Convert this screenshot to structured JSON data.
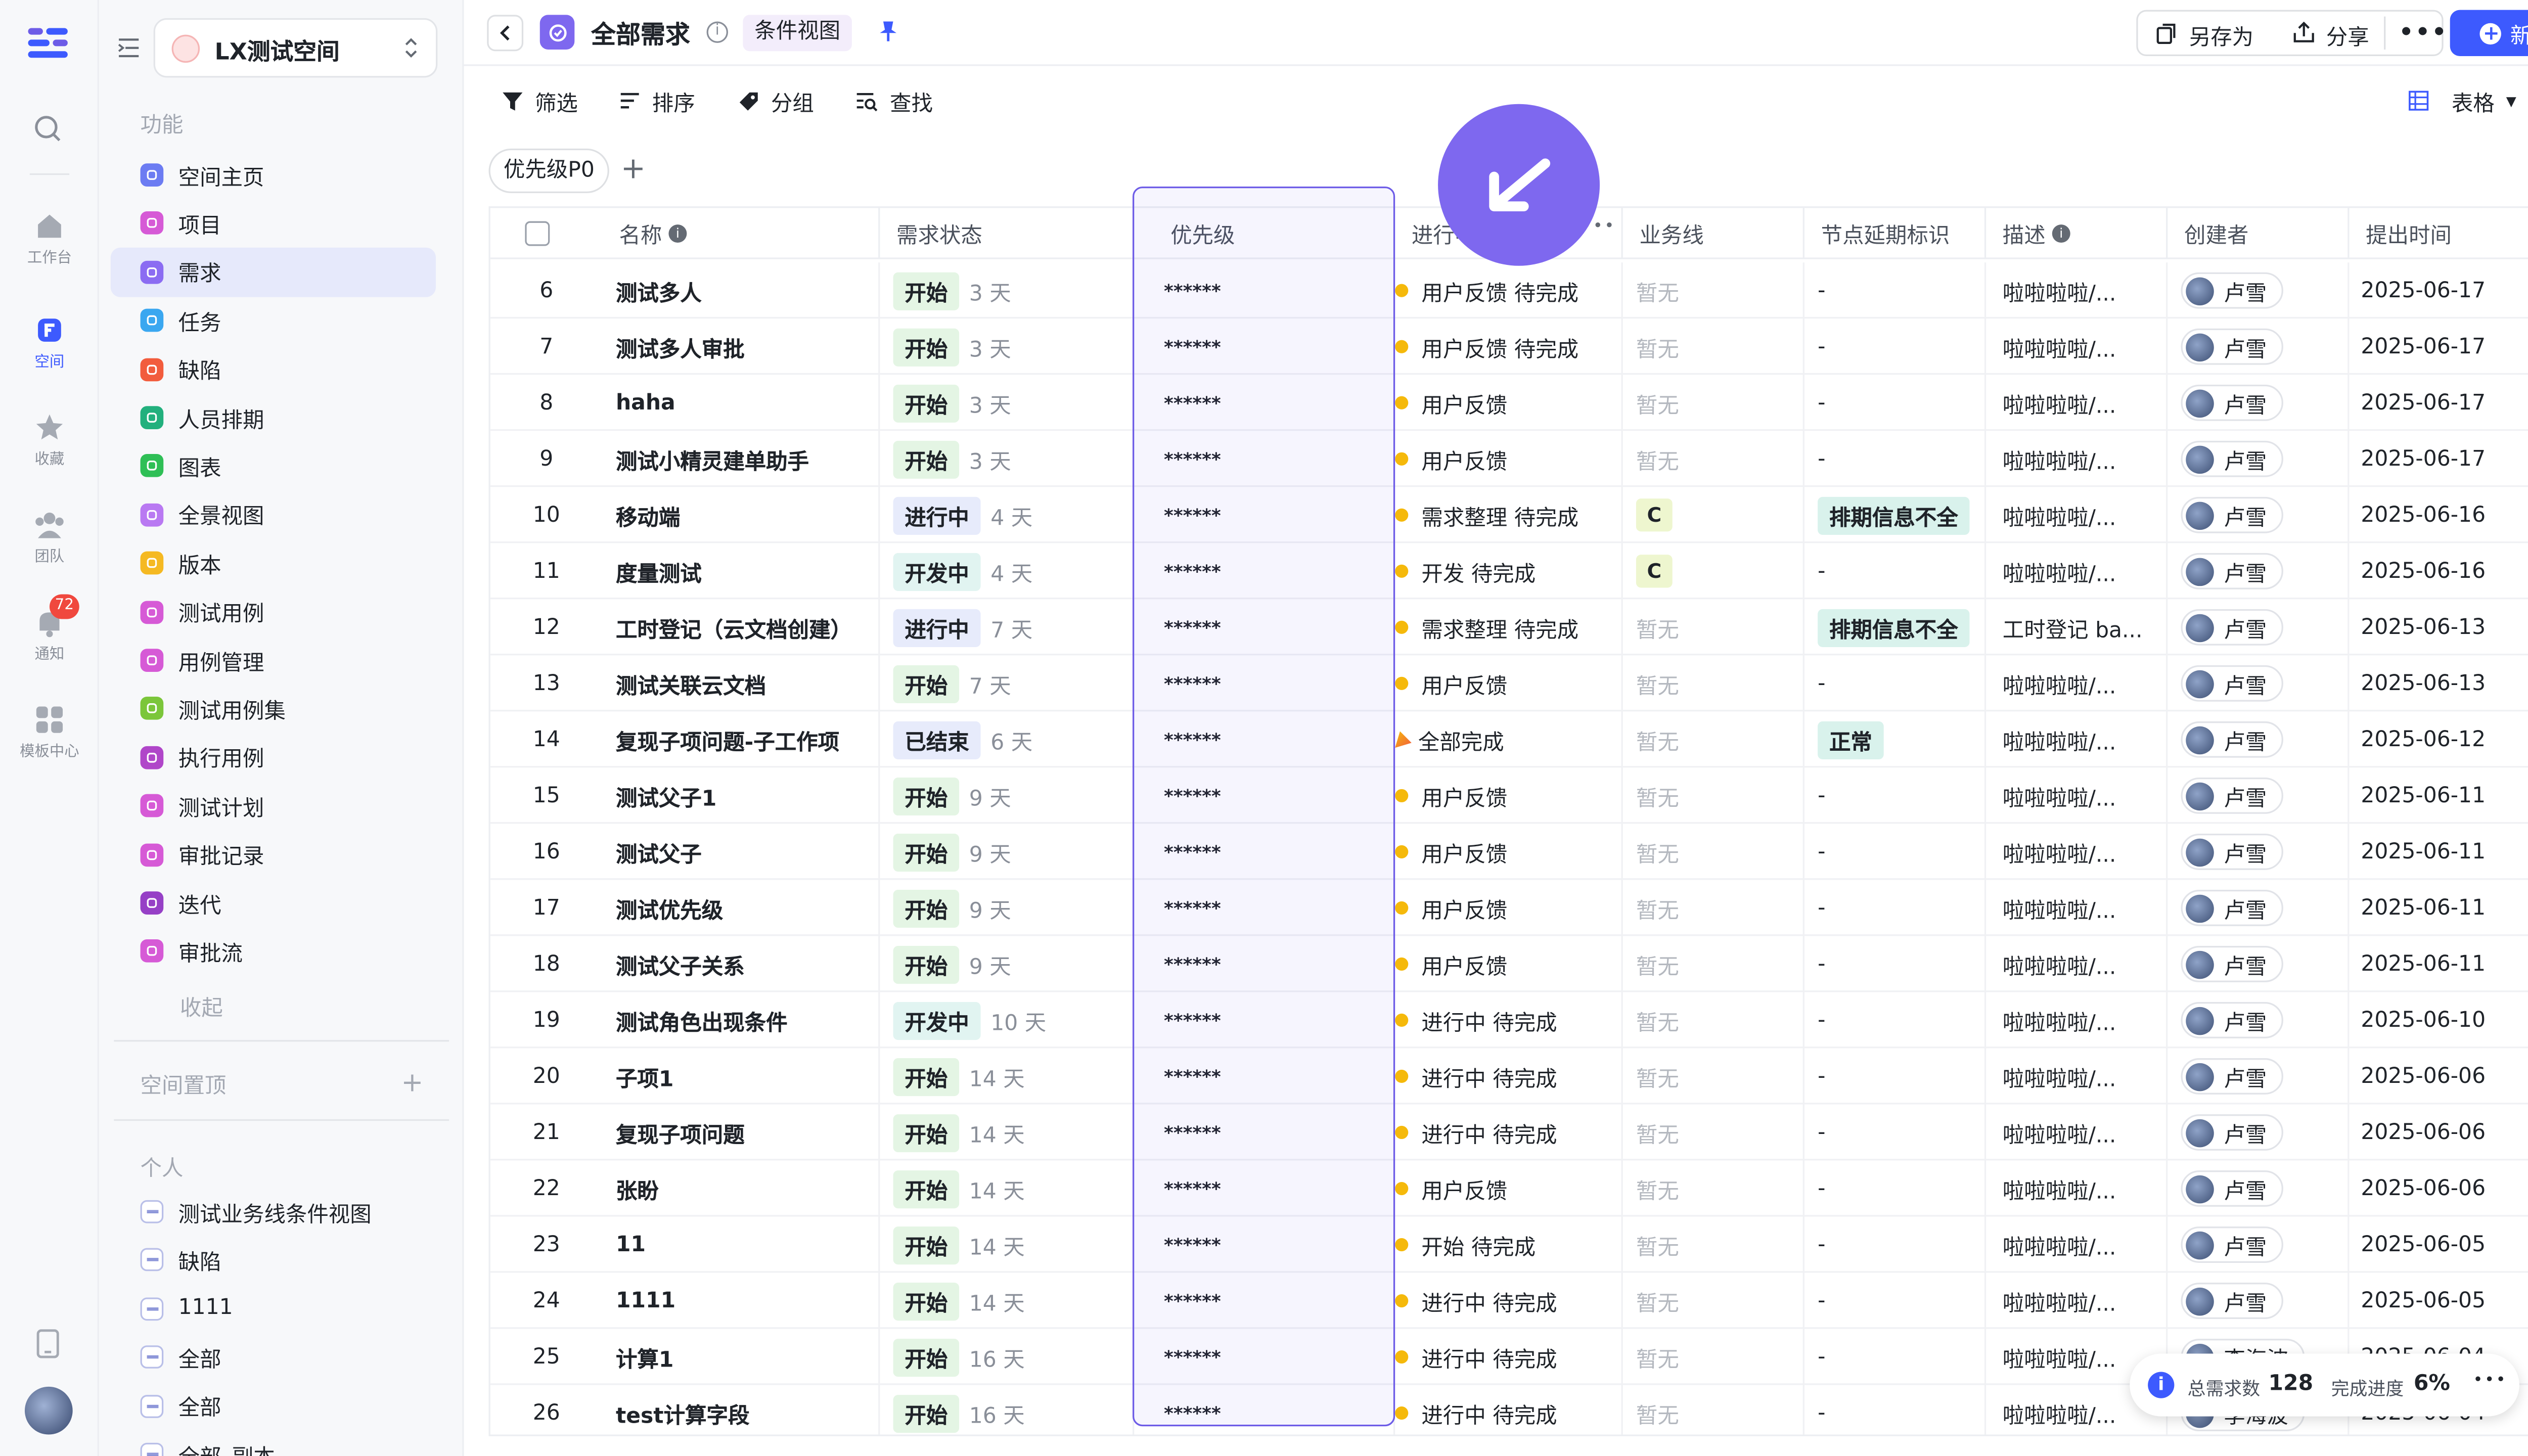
{
  "rail": {
    "items": [
      {
        "label": "工作台",
        "icon": "home-icon"
      },
      {
        "label": "空间",
        "icon": "space-icon"
      },
      {
        "label": "收藏",
        "icon": "star-icon"
      },
      {
        "label": "团队",
        "icon": "team-icon"
      },
      {
        "label": "通知",
        "icon": "bell-icon",
        "badge": "72"
      },
      {
        "label": "模板中心",
        "icon": "template-icon"
      }
    ]
  },
  "sidebar": {
    "space_name": "LX测试空间",
    "section_features": "功能",
    "items": [
      {
        "label": "空间主页",
        "color": "#6c7cf2"
      },
      {
        "label": "项目",
        "color": "#d65ad6"
      },
      {
        "label": "需求",
        "color": "#8b6cf2"
      },
      {
        "label": "任务",
        "color": "#3aa7f0"
      },
      {
        "label": "缺陷",
        "color": "#f25c3d"
      },
      {
        "label": "人员排期",
        "color": "#22b07d"
      },
      {
        "label": "图表",
        "color": "#2fbf56"
      },
      {
        "label": "全景视图",
        "color": "#b979f2"
      },
      {
        "label": "版本",
        "color": "#f5b922"
      },
      {
        "label": "测试用例",
        "color": "#d65ad6"
      },
      {
        "label": "用例管理",
        "color": "#d65ad6"
      },
      {
        "label": "测试用例集",
        "color": "#7bc63a"
      },
      {
        "label": "执行用例",
        "color": "#b046c9"
      },
      {
        "label": "测试计划",
        "color": "#d65ad6"
      },
      {
        "label": "审批记录",
        "color": "#d65ad6"
      },
      {
        "label": "迭代",
        "color": "#9640c6"
      },
      {
        "label": "审批流",
        "color": "#d65ad6"
      }
    ],
    "collapse": "收起",
    "section_pinned": "空间置顶",
    "section_personal": "个人",
    "personal": [
      "测试业务线条件视图",
      "缺陷",
      "1111",
      "全部",
      "全部",
      "全部_副本"
    ]
  },
  "header": {
    "title": "全部需求",
    "view_tag": "条件视图",
    "save_as": "另存为",
    "share": "分享",
    "new": "新建"
  },
  "toolbar": {
    "filter": "筛选",
    "sort": "排序",
    "group": "分组",
    "find": "查找",
    "view": "表格"
  },
  "group_tab": "优先级P0",
  "columns": [
    "名称",
    "需求状态",
    "优先级",
    "进行中",
    "业务线",
    "节点延期标识",
    "描述",
    "创建者",
    "提出时间"
  ],
  "rows": [
    {
      "no": "6",
      "name": "测试多人",
      "status": "开始",
      "st": "start",
      "days": "3 天",
      "pri": "******",
      "prog": "用户反馈 待完成",
      "biz": "暂无",
      "delay": "-",
      "desc": "啦啦啦啦/...",
      "creator": "卢雪",
      "date": "2025-06-17"
    },
    {
      "no": "7",
      "name": "测试多人审批",
      "status": "开始",
      "st": "start",
      "days": "3 天",
      "pri": "******",
      "prog": "用户反馈 待完成",
      "biz": "暂无",
      "delay": "-",
      "desc": "啦啦啦啦/...",
      "creator": "卢雪",
      "date": "2025-06-17"
    },
    {
      "no": "8",
      "name": "haha",
      "status": "开始",
      "st": "start",
      "days": "3 天",
      "pri": "******",
      "prog": "用户反馈",
      "biz": "暂无",
      "delay": "-",
      "desc": "啦啦啦啦/...",
      "creator": "卢雪",
      "date": "2025-06-17"
    },
    {
      "no": "9",
      "name": "测试小精灵建单助手",
      "status": "开始",
      "st": "start",
      "days": "3 天",
      "pri": "******",
      "prog": "用户反馈",
      "biz": "暂无",
      "delay": "-",
      "desc": "啦啦啦啦/...",
      "creator": "卢雪",
      "date": "2025-06-17"
    },
    {
      "no": "10",
      "name": "移动端",
      "status": "进行中",
      "st": "doing",
      "days": "4 天",
      "pri": "******",
      "prog": "需求整理 待完成",
      "biz": "C",
      "delay": "排期信息不全",
      "desc": "啦啦啦啦/...",
      "creator": "卢雪",
      "date": "2025-06-16"
    },
    {
      "no": "11",
      "name": "度量测试",
      "status": "开发中",
      "st": "dev",
      "days": "4 天",
      "pri": "******",
      "prog": "开发 待完成",
      "biz": "C",
      "delay": "-",
      "desc": "啦啦啦啦/...",
      "creator": "卢雪",
      "date": "2025-06-16"
    },
    {
      "no": "12",
      "name": "工时登记（云文档创建）",
      "status": "进行中",
      "st": "doing",
      "days": "7 天",
      "pri": "******",
      "prog": "需求整理 待完成",
      "biz": "暂无",
      "delay": "排期信息不全",
      "desc": "工时登记 ba...",
      "creator": "卢雪",
      "date": "2025-06-13"
    },
    {
      "no": "13",
      "name": "测试关联云文档",
      "status": "开始",
      "st": "start",
      "days": "7 天",
      "pri": "******",
      "prog": "用户反馈",
      "biz": "暂无",
      "delay": "-",
      "desc": "啦啦啦啦/...",
      "creator": "卢雪",
      "date": "2025-06-13"
    },
    {
      "no": "14",
      "name": "复现子项问题-子工作项",
      "status": "已结束",
      "st": "end",
      "days": "6 天",
      "pri": "******",
      "prog": "全部完成",
      "biz": "暂无",
      "delay": "正常",
      "desc": "啦啦啦啦/...",
      "creator": "卢雪",
      "date": "2025-06-12"
    },
    {
      "no": "15",
      "name": "测试父子1",
      "status": "开始",
      "st": "start",
      "days": "9 天",
      "pri": "******",
      "prog": "用户反馈",
      "biz": "暂无",
      "delay": "-",
      "desc": "啦啦啦啦/...",
      "creator": "卢雪",
      "date": "2025-06-11"
    },
    {
      "no": "16",
      "name": "测试父子",
      "status": "开始",
      "st": "start",
      "days": "9 天",
      "pri": "******",
      "prog": "用户反馈",
      "biz": "暂无",
      "delay": "-",
      "desc": "啦啦啦啦/...",
      "creator": "卢雪",
      "date": "2025-06-11"
    },
    {
      "no": "17",
      "name": "测试优先级",
      "status": "开始",
      "st": "start",
      "days": "9 天",
      "pri": "******",
      "prog": "用户反馈",
      "biz": "暂无",
      "delay": "-",
      "desc": "啦啦啦啦/...",
      "creator": "卢雪",
      "date": "2025-06-11"
    },
    {
      "no": "18",
      "name": "测试父子关系",
      "status": "开始",
      "st": "start",
      "days": "9 天",
      "pri": "******",
      "prog": "用户反馈",
      "biz": "暂无",
      "delay": "-",
      "desc": "啦啦啦啦/...",
      "creator": "卢雪",
      "date": "2025-06-11"
    },
    {
      "no": "19",
      "name": "测试角色出现条件",
      "status": "开发中",
      "st": "dev",
      "days": "10 天",
      "pri": "******",
      "prog": "进行中 待完成",
      "biz": "暂无",
      "delay": "-",
      "desc": "啦啦啦啦/...",
      "creator": "卢雪",
      "date": "2025-06-10"
    },
    {
      "no": "20",
      "name": "子项1",
      "status": "开始",
      "st": "start",
      "days": "14 天",
      "pri": "******",
      "prog": "进行中 待完成",
      "biz": "暂无",
      "delay": "-",
      "desc": "啦啦啦啦/...",
      "creator": "卢雪",
      "date": "2025-06-06"
    },
    {
      "no": "21",
      "name": "复现子项问题",
      "status": "开始",
      "st": "start",
      "days": "14 天",
      "pri": "******",
      "prog": "进行中 待完成",
      "biz": "暂无",
      "delay": "-",
      "desc": "啦啦啦啦/...",
      "creator": "卢雪",
      "date": "2025-06-06"
    },
    {
      "no": "22",
      "name": "张盼",
      "status": "开始",
      "st": "start",
      "days": "14 天",
      "pri": "******",
      "prog": "用户反馈",
      "biz": "暂无",
      "delay": "-",
      "desc": "啦啦啦啦/...",
      "creator": "卢雪",
      "date": "2025-06-06"
    },
    {
      "no": "23",
      "name": "11",
      "status": "开始",
      "st": "start",
      "days": "14 天",
      "pri": "******",
      "prog": "开始 待完成",
      "biz": "暂无",
      "delay": "-",
      "desc": "啦啦啦啦/...",
      "creator": "卢雪",
      "date": "2025-06-05"
    },
    {
      "no": "24",
      "name": "1111",
      "status": "开始",
      "st": "start",
      "days": "14 天",
      "pri": "******",
      "prog": "进行中 待完成",
      "biz": "暂无",
      "delay": "-",
      "desc": "啦啦啦啦/...",
      "creator": "卢雪",
      "date": "2025-06-05"
    },
    {
      "no": "25",
      "name": "计算1",
      "status": "开始",
      "st": "start",
      "days": "16 天",
      "pri": "******",
      "prog": "进行中 待完成",
      "biz": "暂无",
      "delay": "-",
      "desc": "啦啦啦啦/...",
      "creator": "李海波",
      "date": "2025-06-04"
    },
    {
      "no": "26",
      "name": "test计算字段",
      "status": "开始",
      "st": "start",
      "days": "16 天",
      "pri": "******",
      "prog": "进行中 待完成",
      "biz": "暂无",
      "delay": "-",
      "desc": "啦啦啦啦/...",
      "creator": "李海波",
      "date": "2025-06-04"
    }
  ],
  "summary": {
    "total_label": "总需求数",
    "total": "128",
    "progress_label": "完成进度",
    "progress": "6%"
  },
  "colors": {
    "accent": "#3d5afe",
    "selection": "#6d5ce7",
    "warn_dot": "#f5b90b"
  }
}
